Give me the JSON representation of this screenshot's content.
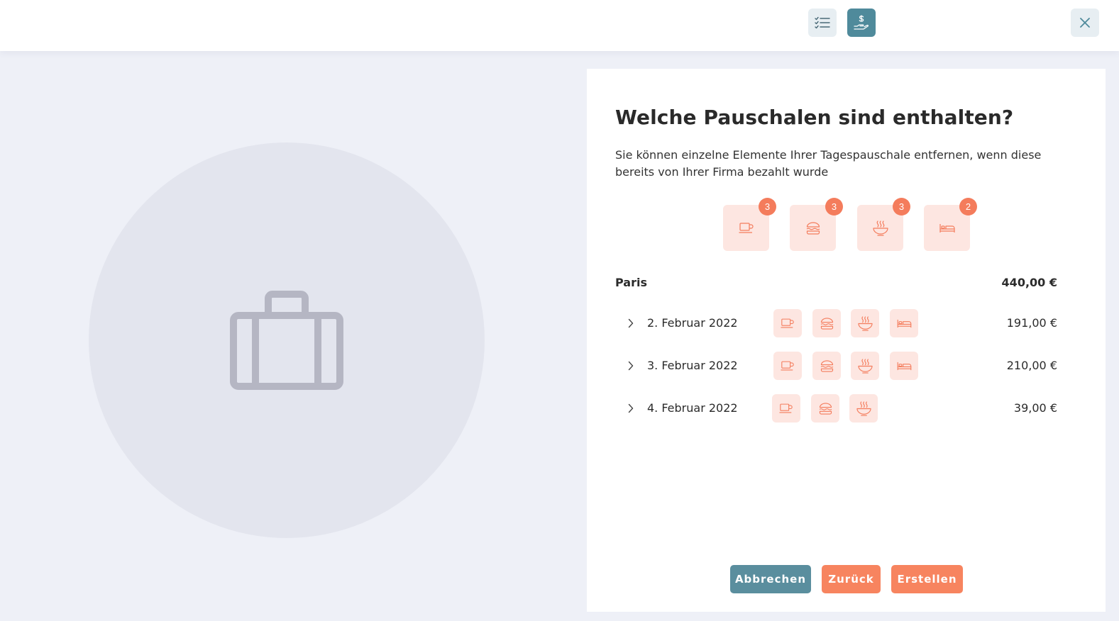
{
  "colors": {
    "accent_teal": "#4f8a9b",
    "accent_orange": "#f47c5c",
    "tile_bg": "#fde6e1",
    "panel_bg": "#ffffff",
    "page_bg": "#eef0f7"
  },
  "topbar": {
    "icons": [
      "checklist-icon",
      "hand-money-icon",
      "close-icon"
    ]
  },
  "panel": {
    "title": "Welche Pauschalen sind enthalten?",
    "subtitle": "Sie können einzelne Elemente Ihrer Tagespauschale entfernen, wenn diese bereits von Ihrer Firma bezahlt wurde",
    "summary": [
      {
        "icon": "coffee-icon",
        "count": "3"
      },
      {
        "icon": "burger-icon",
        "count": "3"
      },
      {
        "icon": "bowl-icon",
        "count": "3"
      },
      {
        "icon": "bed-icon",
        "count": "2"
      }
    ],
    "city": "Paris",
    "total": "440,00 €",
    "days": [
      {
        "date": "2. Februar 2022",
        "amount": "191,00 €",
        "icons": [
          "coffee-icon",
          "burger-icon",
          "bowl-icon",
          "bed-icon"
        ]
      },
      {
        "date": "3. Februar 2022",
        "amount": "210,00 €",
        "icons": [
          "coffee-icon",
          "burger-icon",
          "bowl-icon",
          "bed-icon"
        ]
      },
      {
        "date": "4. Februar 2022",
        "amount": "39,00 €",
        "icons": [
          "coffee-icon",
          "burger-icon",
          "bowl-icon"
        ]
      }
    ],
    "buttons": {
      "cancel": "Abbrechen",
      "back": "Zurück",
      "create": "Erstellen"
    }
  }
}
